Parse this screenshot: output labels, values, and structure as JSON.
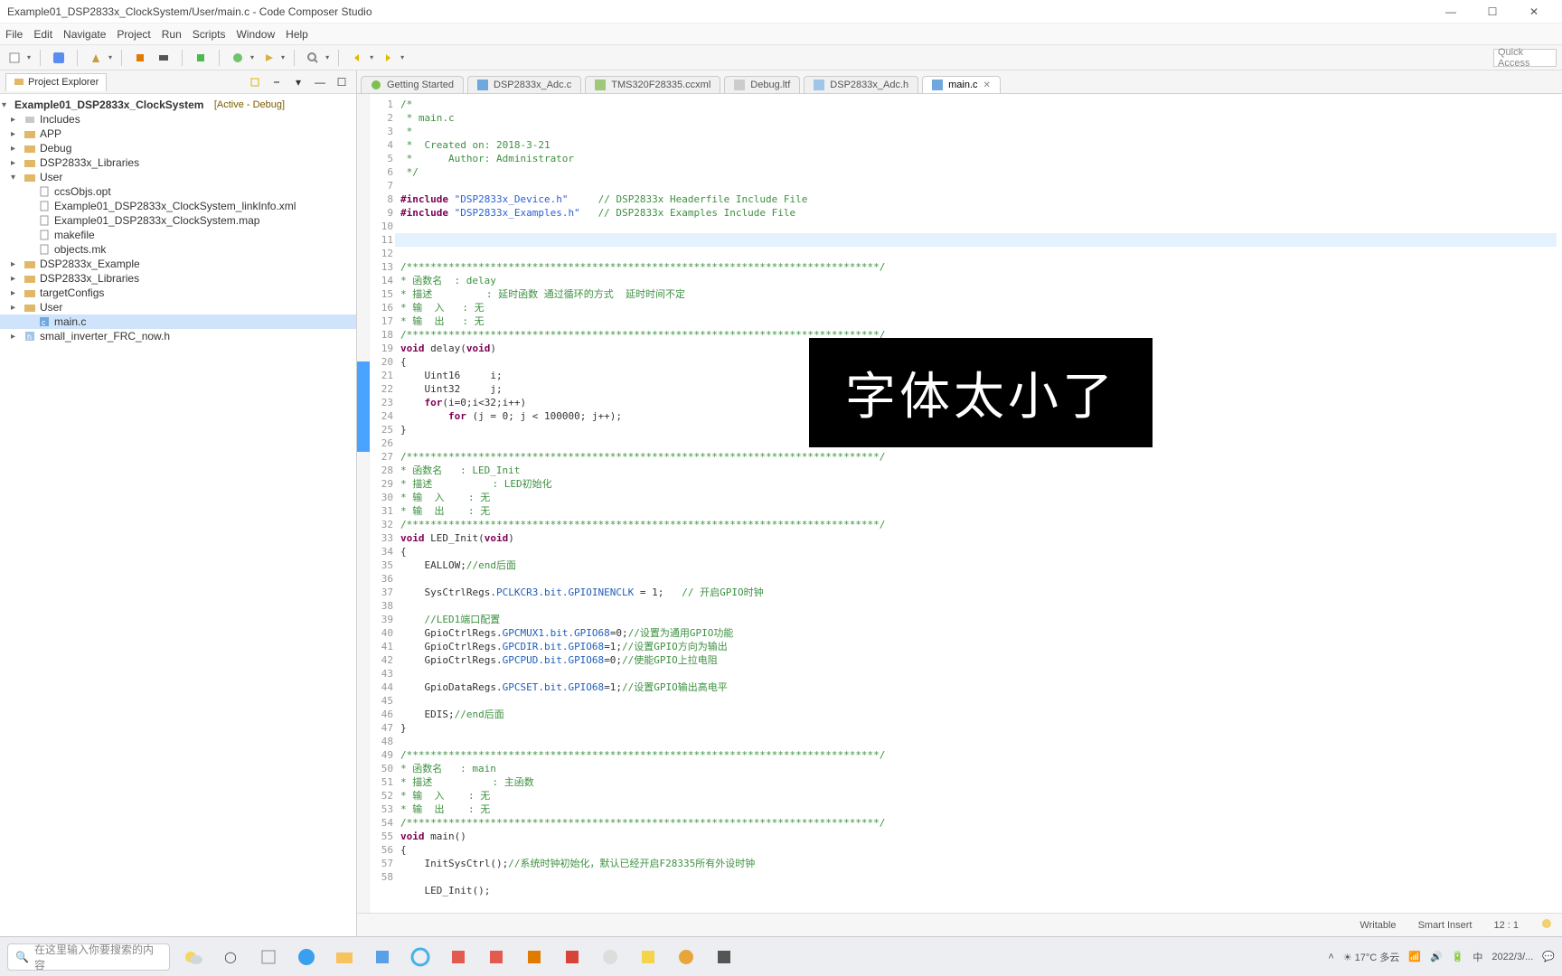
{
  "window_title": "Example01_DSP2833x_ClockSystem/User/main.c - Code Composer Studio",
  "menus": [
    "File",
    "Edit",
    "Navigate",
    "Project",
    "Run",
    "Scripts",
    "Window",
    "Help"
  ],
  "quick_access_placeholder": "Quick Access",
  "explorer": {
    "tab_label": "Project Explorer",
    "project_name": "Example01_DSP2833x_ClockSystem",
    "project_status": "[Active - Debug]",
    "items": [
      {
        "label": "Includes",
        "level": 1,
        "icon": "inc"
      },
      {
        "label": "APP",
        "level": 1,
        "icon": "folder"
      },
      {
        "label": "Debug",
        "level": 1,
        "icon": "folder"
      },
      {
        "label": "DSP2833x_Libraries",
        "level": 1,
        "icon": "folder"
      },
      {
        "label": "User",
        "level": 1,
        "icon": "folder",
        "expanded": true
      },
      {
        "label": "ccsObjs.opt",
        "level": 2,
        "icon": "file"
      },
      {
        "label": "Example01_DSP2833x_ClockSystem_linkInfo.xml",
        "level": 2,
        "icon": "file"
      },
      {
        "label": "Example01_DSP2833x_ClockSystem.map",
        "level": 2,
        "icon": "file"
      },
      {
        "label": "makefile",
        "level": 2,
        "icon": "file"
      },
      {
        "label": "objects.mk",
        "level": 2,
        "icon": "file"
      },
      {
        "label": "DSP2833x_Example",
        "level": 1,
        "icon": "folder"
      },
      {
        "label": "DSP2833x_Libraries",
        "level": 1,
        "icon": "folder"
      },
      {
        "label": "targetConfigs",
        "level": 1,
        "icon": "folder"
      },
      {
        "label": "User",
        "level": 1,
        "icon": "folder"
      },
      {
        "label": "main.c",
        "level": 2,
        "icon": "c",
        "selected": true
      },
      {
        "label": "small_inverter_FRC_now.h",
        "level": 1,
        "icon": "h"
      }
    ]
  },
  "editor_tabs": [
    {
      "label": "Getting Started",
      "icon": "ccs"
    },
    {
      "label": "DSP2833x_Adc.c",
      "icon": "c"
    },
    {
      "label": "TMS320F28335.ccxml",
      "icon": "xml"
    },
    {
      "label": "Debug.ltf",
      "icon": "file"
    },
    {
      "label": "DSP2833x_Adc.h",
      "icon": "h"
    },
    {
      "label": "main.c",
      "icon": "c",
      "active": true
    }
  ],
  "code_meta": {
    "file_header": [
      "/*",
      " * main.c",
      " *",
      " *  Created on: 2018-3-21",
      " *      Author: Administrator",
      " */",
      ""
    ]
  },
  "code_lines_count": 60,
  "include_1_kw": "#include",
  "include_1_str": "\"DSP2833x_Device.h\"",
  "include_1_cmt": "// DSP2833x Headerfile Include File",
  "include_2_kw": "#include",
  "include_2_str": "\"DSP2833x_Examples.h\"",
  "include_2_cmt": "// DSP2833x Examples Include File",
  "cmt_bar": "/*******************************************************************************/",
  "cmt_delay_1": "* 函数名  : delay",
  "cmt_delay_2": "* 描述         : 延时函数 通过循环的方式  延时时间不定",
  "cmt_delay_3": "* 输  入   : 无",
  "cmt_delay_4": "* 输  出   : 无",
  "fn_delay_sig_kw": "void",
  "fn_delay_sig_name": " delay(",
  "fn_delay_sig_arg": "void",
  "fn_delay_sig_close": ")",
  "fn_delay_body_1": "    Uint16     i;",
  "fn_delay_body_2_a": "    Uint32     j",
  "fn_delay_body_2_b": ";",
  "fn_delay_body_3_kw": "    for",
  "fn_delay_body_3_rest": "(i=0;i<32;i++)",
  "fn_delay_body_4_kw": "        for",
  "fn_delay_body_4_rest": " (j = 0; j < 100000; j++);",
  "cmt_led_1": "* 函数名   : LED_Init",
  "cmt_led_2": "* 描述          : LED初始化",
  "cmt_led_3": "* 输  入    : 无",
  "cmt_led_4": "* 输  出    : 无",
  "fn_led_sig_kw": "void",
  "fn_led_sig_name": " LED_Init(",
  "fn_led_sig_arg": "void",
  "fn_led_sig_close": ")",
  "fn_led_l1": "    EALLOW;",
  "fn_led_l1_cmt": "//end后面",
  "fn_led_l2_a": "    SysCtrlRegs.",
  "fn_led_l2_b": "PCLKCR3.bit.GPIOINENCLK",
  "fn_led_l2_c": " = 1;",
  "fn_led_l2_cmt": "   // 开启GPIO时钟",
  "fn_led_c1": "    //LED1端口配置",
  "fn_led_l3_a": "    GpioCtrlRegs.",
  "fn_led_l3_b": "GPCMUX1.bit.GPIO68",
  "fn_led_l3_c": "=0;",
  "fn_led_l3_cmt": "//设置为通用GPIO功能",
  "fn_led_l4_a": "    GpioCtrlRegs.",
  "fn_led_l4_b": "GPCDIR.bit.GPIO68",
  "fn_led_l4_c": "=1;",
  "fn_led_l4_cmt": "//设置GPIO方向为输出",
  "fn_led_l5_a": "    GpioCtrlRegs.",
  "fn_led_l5_b": "GPCPUD.bit.GPIO68",
  "fn_led_l5_c": "=0;",
  "fn_led_l5_cmt": "//使能GPIO上拉电阻",
  "fn_led_l6_a": "    GpioDataRegs.",
  "fn_led_l6_b": "GPCSET.bit.GPIO68",
  "fn_led_l6_c": "=1;",
  "fn_led_l6_cmt": "//设置GPIO输出高电平",
  "fn_led_l7": "    EDIS;",
  "fn_led_l7_cmt": "//end后面",
  "cmt_main_1": "* 函数名   : main",
  "cmt_main_2": "* 描述          : 主函数",
  "cmt_main_3": "* 输  入    : 无",
  "cmt_main_4": "* 输  出    : 无",
  "fn_main_sig_kw": "void",
  "fn_main_sig_name": " main()",
  "fn_main_l1": "    InitSysCtrl();",
  "fn_main_l1_cmt": "//系统时钟初始化，默认已经开启F28335所有外设时钟",
  "fn_main_l2": "    LED_Init();",
  "overlay_text": "字体太小了",
  "status": {
    "writable": "Writable",
    "insert": "Smart Insert",
    "pos": "12 : 1"
  },
  "taskbar": {
    "search_placeholder": "在这里输入你要搜索的内容",
    "weather": "17°C 多云",
    "time": "2022/3/..."
  }
}
